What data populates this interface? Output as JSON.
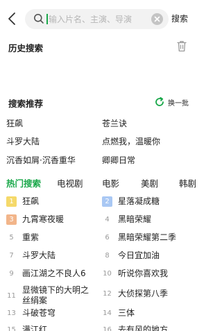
{
  "search": {
    "placeholder": "输入片名、主演、导演",
    "button_label": "搜索"
  },
  "history": {
    "title": "历史搜索"
  },
  "recommend": {
    "title": "搜索推荐",
    "refresh_label": "换一批",
    "items": [
      "狂飙",
      "苍兰诀",
      "斗罗大陆",
      "点燃我，温暖你",
      "沉香如屑·沉香重华",
      "卿卿日常"
    ]
  },
  "tabs": [
    {
      "label": "热门搜索",
      "active": true
    },
    {
      "label": "电视剧",
      "active": false
    },
    {
      "label": "电影",
      "active": false
    },
    {
      "label": "美剧",
      "active": false
    },
    {
      "label": "韩剧",
      "active": false
    }
  ],
  "ranking": [
    {
      "rank": "1",
      "title": "狂飙"
    },
    {
      "rank": "2",
      "title": "星落凝成糖"
    },
    {
      "rank": "3",
      "title": "九霄寒夜暖"
    },
    {
      "rank": "4",
      "title": "黑暗荣耀"
    },
    {
      "rank": "5",
      "title": "重紫"
    },
    {
      "rank": "6",
      "title": "黑暗荣耀第二季"
    },
    {
      "rank": "7",
      "title": "斗罗大陆"
    },
    {
      "rank": "8",
      "title": "今日宜加油"
    },
    {
      "rank": "9",
      "title": "画江湖之不良人6"
    },
    {
      "rank": "10",
      "title": "听说你喜欢我"
    },
    {
      "rank": "11",
      "title": "显微镜下的大明之丝绢案"
    },
    {
      "rank": "12",
      "title": "大侦探第八季"
    },
    {
      "rank": "13",
      "title": "斗破苍穹"
    },
    {
      "rank": "14",
      "title": "三体"
    },
    {
      "rank": "15",
      "title": "满江红"
    },
    {
      "rank": "16",
      "title": "去有风的地方"
    }
  ],
  "colors": {
    "accent": "#1aa84a",
    "rank1": "#f5d96a",
    "rank2": "#a9c8f4",
    "rank3": "#f2b58a"
  },
  "icons": {
    "back": "chevron-left-icon",
    "search": "search-icon",
    "clear": "clear-icon",
    "trash": "trash-icon",
    "refresh": "refresh-icon"
  }
}
